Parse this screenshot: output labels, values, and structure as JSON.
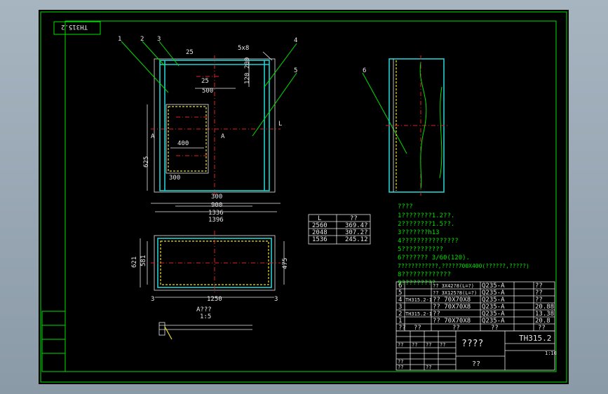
{
  "drawing": {
    "drawing_no": "TH315.2",
    "drawing_no_mirrored": "TH315.2",
    "title_block": {
      "name": "????",
      "sub": "??",
      "scale": "1:10",
      "code": "TH315.2"
    },
    "section_label": "A???",
    "section_scale": "1:5",
    "section_marker": "A"
  },
  "callouts": [
    "1",
    "2",
    "3",
    "4",
    "5",
    "6"
  ],
  "dimensions": {
    "front": [
      "500",
      "400",
      "300",
      "300",
      "900",
      "1336",
      "1396",
      "625",
      "120",
      "200",
      "25",
      "25",
      "5x8",
      "L"
    ],
    "plan": [
      "1250",
      "621",
      "581",
      "475",
      "3",
      "3"
    ]
  },
  "length_table": {
    "headers": [
      "L",
      "??"
    ],
    "rows": [
      [
        "2560",
        "369.4?"
      ],
      [
        "2048",
        "307.2?"
      ],
      [
        "1536",
        "245.12"
      ]
    ]
  },
  "notes": {
    "title": "????",
    "lines": [
      "1????????1.2??.",
      "2????????1.5??.",
      "3???????h13",
      "4???????????????",
      "5???????????",
      "6??????? 3/60(120).",
      "7???????????,?????700X400(??????,?????)",
      "8?????????????",
      "9?????????."
    ]
  },
  "parts_list": {
    "rows": [
      [
        "6",
        "",
        "?? 3X42?8(L=?)",
        "Q235-A",
        "??"
      ],
      [
        "5",
        "",
        "?? 3X125?8(L=?)",
        "Q235-A",
        "??"
      ],
      [
        "4",
        "TH315.2-1",
        "?? 70X70X8",
        "Q235-A",
        "??"
      ],
      [
        "3",
        "",
        "?? 70X70X8",
        "Q235-A",
        "20.88"
      ],
      [
        "2",
        "TH315.2-1",
        "??",
        "Q235-A",
        "13.38"
      ],
      [
        "1",
        "",
        "?? 70X70X8",
        "Q235-A",
        "20.8"
      ]
    ],
    "header": [
      "??",
      "??",
      "??",
      "??",
      "??"
    ]
  },
  "revision_cols": [
    "??",
    "??",
    "??",
    "??",
    "??",
    "??",
    "??"
  ]
}
